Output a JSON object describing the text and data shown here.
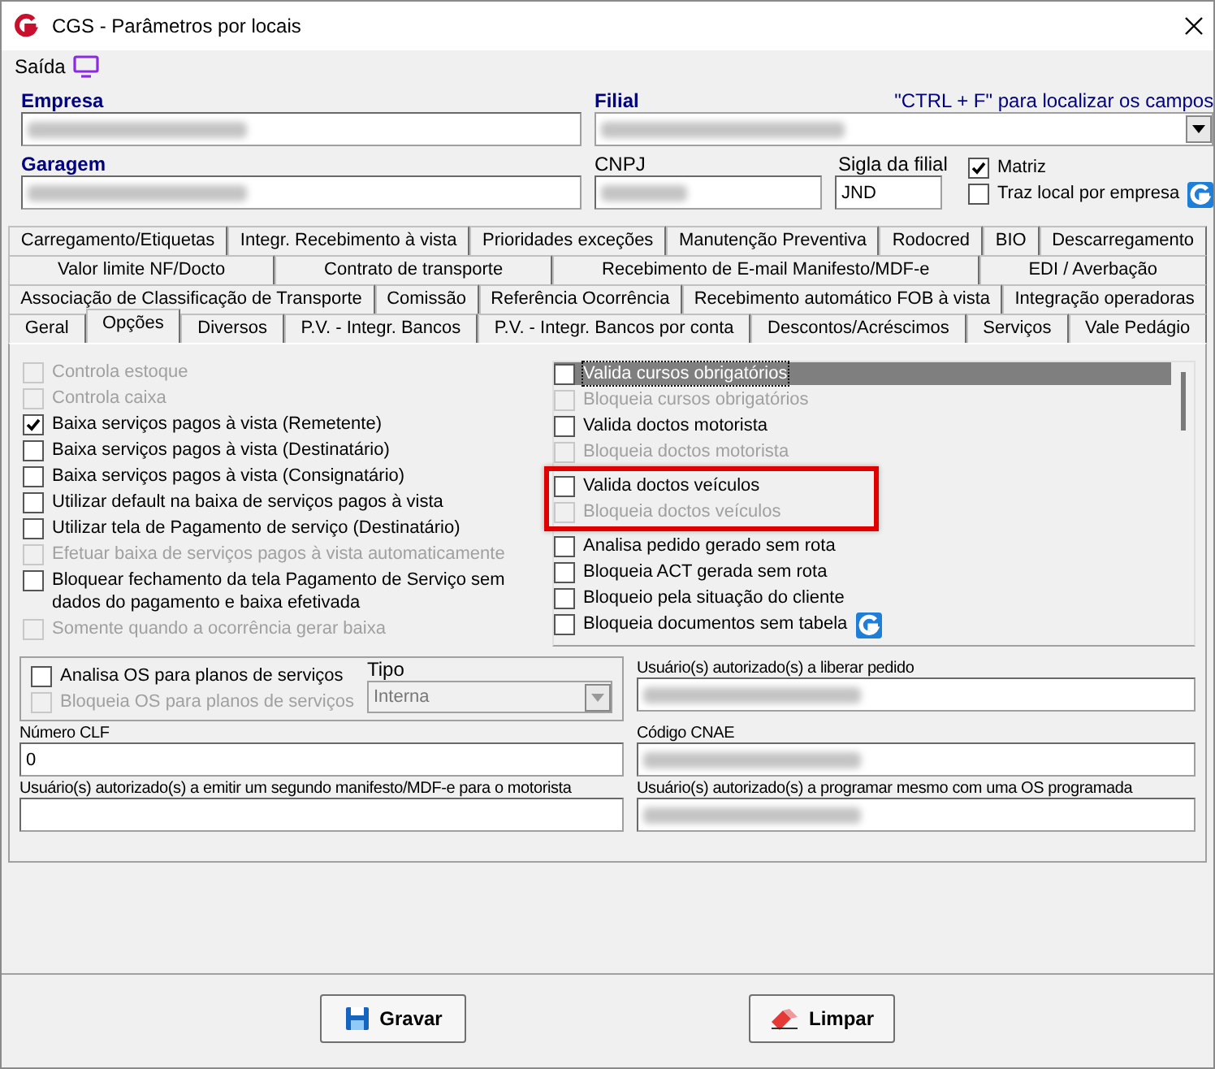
{
  "window": {
    "title": "CGS - Parâmetros por locais"
  },
  "menu": [
    {
      "label": "Saída"
    }
  ],
  "header": {
    "hint": "\"CTRL + F\" para localizar os campos",
    "empresa": {
      "label": "Empresa",
      "redacted": true
    },
    "filial": {
      "label": "Filial",
      "redacted": true
    },
    "garagem": {
      "label": "Garagem",
      "redacted": true
    },
    "cnpj": {
      "label": "CNPJ",
      "redacted": true
    },
    "sigla": {
      "label": "Sigla da filial",
      "value": "JND"
    },
    "checks": [
      {
        "label": "Matriz",
        "checked": true,
        "logo": false
      },
      {
        "label": "Traz local por empresa",
        "checked": false,
        "logo": true
      }
    ]
  },
  "tab_rows": [
    [
      {
        "label": "Carregamento/Etiquetas",
        "selected": false
      },
      {
        "label": "Integr. Recebimento à vista",
        "selected": false
      },
      {
        "label": "Prioridades exceções",
        "selected": false
      },
      {
        "label": "Manutenção Preventiva",
        "selected": false
      },
      {
        "label": "Rodocred",
        "selected": false
      },
      {
        "label": "BIO",
        "selected": false
      },
      {
        "label": "Descarregamento",
        "selected": false
      }
    ],
    [
      {
        "label": "Valor limite NF/Docto",
        "selected": false
      },
      {
        "label": "Contrato de transporte",
        "selected": false
      },
      {
        "label": "Recebimento de E-mail Manifesto/MDF-e",
        "selected": false
      },
      {
        "label": "EDI / Averbação",
        "selected": false
      }
    ],
    [
      {
        "label": "Associação de Classificação de Transporte",
        "selected": false
      },
      {
        "label": "Comissão",
        "selected": false
      },
      {
        "label": "Referência Ocorrência",
        "selected": false
      },
      {
        "label": "Recebimento automático FOB à vista",
        "selected": false
      },
      {
        "label": "Integração operadoras",
        "selected": false
      }
    ],
    [
      {
        "label": "Geral",
        "selected": false
      },
      {
        "label": "Opções",
        "selected": true
      },
      {
        "label": "Diversos",
        "selected": false
      },
      {
        "label": "P.V. - Integr. Bancos",
        "selected": false
      },
      {
        "label": "P.V. - Integr. Bancos por conta",
        "selected": false
      },
      {
        "label": "Descontos/Acréscimos",
        "selected": false
      },
      {
        "label": "Serviços",
        "selected": false
      },
      {
        "label": "Vale Pedágio",
        "selected": false
      }
    ]
  ],
  "left_options": [
    {
      "label": "Controla estoque",
      "checked": false,
      "disabled": true
    },
    {
      "label": "Controla caixa",
      "checked": false,
      "disabled": true
    },
    {
      "label": "Baixa serviços pagos à vista (Remetente)",
      "checked": true,
      "disabled": false
    },
    {
      "label": "Baixa serviços pagos à vista (Destinatário)",
      "checked": false,
      "disabled": false
    },
    {
      "label": "Baixa serviços pagos à vista (Consignatário)",
      "checked": false,
      "disabled": false
    },
    {
      "label": "Utilizar default na baixa de serviços pagos à vista",
      "checked": false,
      "disabled": false
    },
    {
      "label": "Utilizar tela de Pagamento de serviço (Destinatário)",
      "checked": false,
      "disabled": false
    },
    {
      "label": "Efetuar baixa de serviços pagos à vista automaticamente",
      "checked": false,
      "disabled": true
    },
    {
      "label": "Bloquear fechamento da tela Pagamento de Serviço sem dados do pagamento e baixa efetivada",
      "checked": false,
      "disabled": false
    },
    {
      "label": "Somente quando a ocorrência gerar baixa",
      "checked": false,
      "disabled": true
    }
  ],
  "right_options": [
    {
      "label": "Valida cursos obrigatórios",
      "checked": false,
      "disabled": false,
      "selected": true,
      "highlighted": false,
      "logo": false
    },
    {
      "label": "Bloqueia cursos obrigatórios",
      "checked": false,
      "disabled": true,
      "selected": false,
      "highlighted": false,
      "logo": false
    },
    {
      "label": "Valida doctos motorista",
      "checked": false,
      "disabled": false,
      "selected": false,
      "highlighted": false,
      "logo": false
    },
    {
      "label": "Bloqueia doctos motorista",
      "checked": false,
      "disabled": true,
      "selected": false,
      "highlighted": false,
      "logo": false
    },
    {
      "label": "Valida doctos veículos",
      "checked": false,
      "disabled": false,
      "selected": false,
      "highlighted": true,
      "logo": false
    },
    {
      "label": "Bloqueia doctos veículos",
      "checked": false,
      "disabled": true,
      "selected": false,
      "highlighted": true,
      "logo": false
    },
    {
      "label": "Analisa pedido gerado sem rota",
      "checked": false,
      "disabled": false,
      "selected": false,
      "highlighted": false,
      "logo": false
    },
    {
      "label": "Bloqueia ACT gerada sem rota",
      "checked": false,
      "disabled": false,
      "selected": false,
      "highlighted": false,
      "logo": false
    },
    {
      "label": "Bloqueio pela situação do cliente",
      "checked": false,
      "disabled": false,
      "selected": false,
      "highlighted": false,
      "logo": false
    },
    {
      "label": "Bloqueia documentos sem tabela",
      "checked": false,
      "disabled": false,
      "selected": false,
      "highlighted": false,
      "logo": true
    }
  ],
  "os_group": {
    "options": [
      {
        "label": "Analisa OS para planos de serviços",
        "checked": false,
        "disabled": false
      },
      {
        "label": "Bloqueia OS para planos de serviços",
        "checked": false,
        "disabled": true
      }
    ],
    "tipo": {
      "label": "Tipo",
      "value": "Interna",
      "disabled": true
    }
  },
  "fields": [
    {
      "label": "Usuário(s) autorizado(s) a liberar pedido",
      "redacted": true
    },
    {
      "label": "Número CLF",
      "value": "0",
      "redacted": false
    },
    {
      "label": "Código CNAE",
      "redacted": true
    },
    {
      "label": "Usuário(s) autorizado(s) a emitir um segundo manifesto/MDF-e para o motorista",
      "redacted": false
    },
    {
      "label": "Usuário(s) autorizado(s) a programar mesmo com uma OS programada",
      "redacted": true
    }
  ],
  "buttons": [
    {
      "label": "Gravar",
      "kind": "save"
    },
    {
      "label": "Limpar",
      "kind": "clear"
    }
  ]
}
